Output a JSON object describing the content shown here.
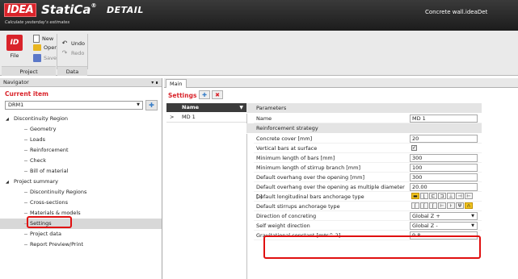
{
  "app": {
    "logo_text": "IDEA",
    "brand": "StatiCa",
    "registered": "®",
    "product": "DETAIL",
    "tagline": "Calculate yesterday's estimates",
    "document_title": "Concrete wall.ideaDet"
  },
  "ribbon": {
    "file_label": "File",
    "new_label": "New",
    "open_label": "Open",
    "save_label": "Save",
    "undo_label": "Undo",
    "redo_label": "Redo",
    "group_project": "Project",
    "group_data": "Data"
  },
  "navigator": {
    "title": "Navigator",
    "pin": "▾ ∎",
    "current_item_label": "Current item",
    "current_item_value": "DRM1",
    "tree": [
      {
        "label": "Discontinuity Region",
        "level": 0,
        "expander": "◢"
      },
      {
        "label": "Geometry",
        "level": 1
      },
      {
        "label": "Loads",
        "level": 1
      },
      {
        "label": "Reinforcement",
        "level": 1
      },
      {
        "label": "Check",
        "level": 1
      },
      {
        "label": "Bill of material",
        "level": 1
      },
      {
        "label": "Project summary",
        "level": 0,
        "expander": "◢"
      },
      {
        "label": "Discontinuity Regions",
        "level": 1
      },
      {
        "label": "Cross-sections",
        "level": 1
      },
      {
        "label": "Materials & models",
        "level": 1
      },
      {
        "label": "Settings",
        "level": 1,
        "selected": true
      },
      {
        "label": "Project data",
        "level": 1
      },
      {
        "label": "Report Preview/Print",
        "level": 1
      }
    ]
  },
  "main": {
    "tab_label": "Main",
    "settings_title": "Settings",
    "list_header": "Name",
    "list_rows": [
      {
        "marker": ">",
        "label": "MD 1"
      }
    ]
  },
  "properties": {
    "section_parameters": "Parameters",
    "name_label": "Name",
    "name_value": "MD 1",
    "section_reinforcement": "Reinforcement strategy",
    "rows": [
      {
        "label": "Concrete cover [mm]",
        "value": "20",
        "kind": "text"
      },
      {
        "label": "Vertical bars at surface",
        "value": "✓",
        "kind": "check"
      },
      {
        "label": "Minimum length of bars [mm]",
        "value": "300",
        "kind": "text"
      },
      {
        "label": "Minimum length of stirrup branch [mm]",
        "value": "100",
        "kind": "text"
      },
      {
        "label": "Default overhang over the opening [mm]",
        "value": "300",
        "kind": "text"
      },
      {
        "label": "Default overhang over the opening as multiple diameter [-]",
        "value": "20.00",
        "kind": "text"
      },
      {
        "label": "Default longitudinal bars anchorage type",
        "value": "",
        "kind": "glyphs-long"
      },
      {
        "label": "Default stirrups anchorage type",
        "value": "",
        "kind": "glyphs-stirrup"
      },
      {
        "label": "Direction of concreting",
        "value": "Global Z +",
        "kind": "select"
      },
      {
        "label": "Self weight direction",
        "value": "Global Z -",
        "kind": "select"
      },
      {
        "label": "Gravitational constant [m*s^-2]",
        "value": "9.8",
        "kind": "text"
      }
    ]
  }
}
